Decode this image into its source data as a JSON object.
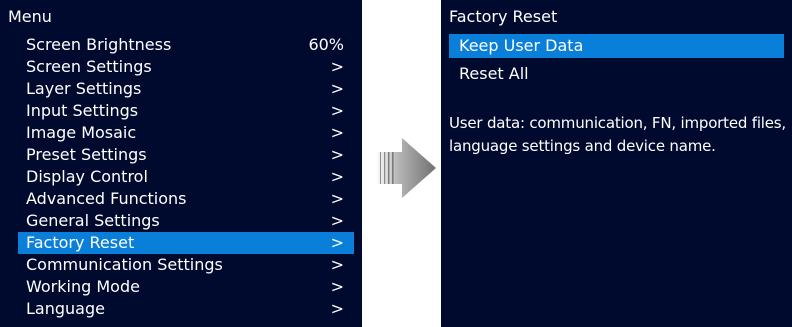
{
  "menu": {
    "title": "Menu",
    "items": [
      {
        "label": "Screen Brightness",
        "value": "60%"
      },
      {
        "label": "Screen Settings",
        "value": ">"
      },
      {
        "label": "Layer Settings",
        "value": ">"
      },
      {
        "label": "Input Settings",
        "value": ">"
      },
      {
        "label": "Image Mosaic",
        "value": ">"
      },
      {
        "label": "Preset Settings",
        "value": ">"
      },
      {
        "label": "Display Control",
        "value": ">"
      },
      {
        "label": "Advanced Functions",
        "value": ">"
      },
      {
        "label": "General Settings",
        "value": ">"
      },
      {
        "label": "Factory Reset",
        "value": ">"
      },
      {
        "label": "Communication Settings",
        "value": ">"
      },
      {
        "label": "Working Mode",
        "value": ">"
      },
      {
        "label": "Language",
        "value": ">"
      }
    ],
    "selected_index": 9
  },
  "detail": {
    "title": "Factory Reset",
    "options": [
      {
        "label": "Keep User Data"
      },
      {
        "label": "Reset All"
      }
    ],
    "selected_index": 0,
    "description": "User data: communication, FN, imported files, language settings and device name."
  },
  "icons": {
    "transition_arrow": "right-arrow-icon"
  },
  "colors": {
    "panel_background": "#000a2e",
    "highlight": "#0a7fd9",
    "text": "#ffffff"
  }
}
